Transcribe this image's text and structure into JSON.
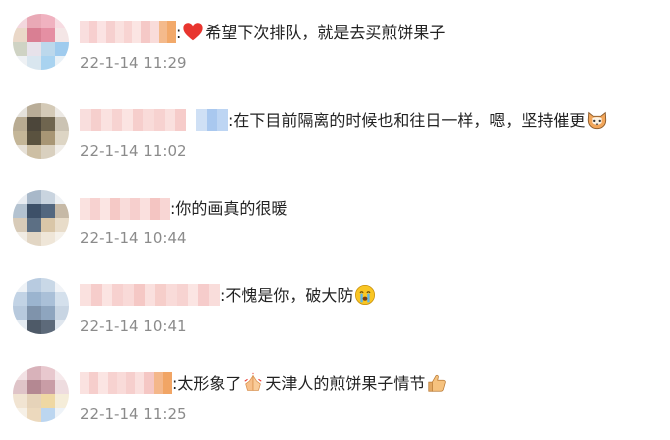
{
  "comments": [
    {
      "text_before": ":",
      "emoji": "heart-icon",
      "text_after": "希望下次排队，就是去买煎饼果子",
      "time": "22-1-14 11:29"
    },
    {
      "text_before": ":在下目前隔离的时候也和往日一样，嗯，坚持催更",
      "emoji": "cat-face-icon",
      "text_after": "",
      "time": "22-1-14 11:02"
    },
    {
      "text_before": ":你的画真的很暖",
      "emoji": "",
      "text_after": "",
      "time": "22-1-14 10:44"
    },
    {
      "text_before": ":不愧是你，破大防",
      "emoji": "crying-face-icon",
      "text_after": "",
      "time": "22-1-14 10:41"
    },
    {
      "text_before": ":太形象了",
      "emoji": "folded-hands-icon",
      "text_after": "天津人的煎饼果子情节",
      "emoji2": "thumbs-up-icon",
      "time": "22-1-14 11:25"
    }
  ],
  "colors": {
    "text": "#222222",
    "time": "#8b8b8b",
    "heart": "#e8352e",
    "blur_pink": "#f7c9c8"
  }
}
